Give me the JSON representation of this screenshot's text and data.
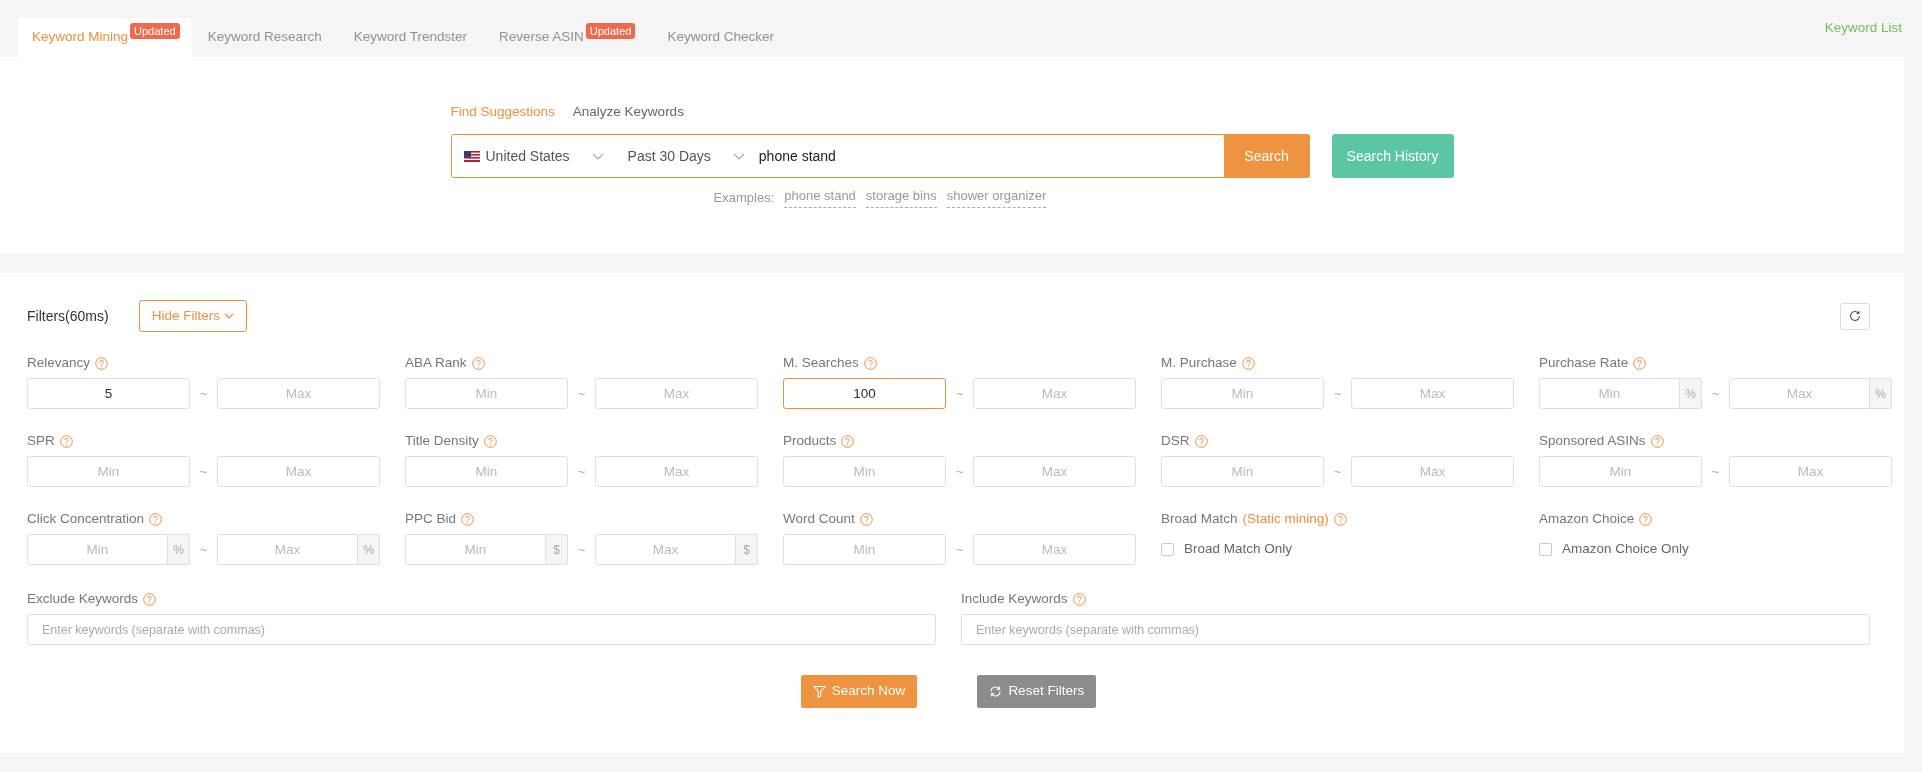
{
  "tabs": [
    {
      "label": "Keyword Mining",
      "badge": "Updated",
      "selected": true
    },
    {
      "label": "Keyword Research",
      "selected": false
    },
    {
      "label": "Keyword Trendster",
      "selected": false
    },
    {
      "label": "Reverse ASIN",
      "badge": "Updated",
      "selected": false
    },
    {
      "label": "Keyword Checker",
      "selected": false
    }
  ],
  "keyword_list_link": "Keyword List",
  "search": {
    "modes": [
      {
        "label": "Find Suggestions",
        "selected": true
      },
      {
        "label": "Analyze Keywords",
        "selected": false
      }
    ],
    "country": "United States",
    "period": "Past 30 Days",
    "query": "phone stand",
    "search_button": "Search",
    "history_button": "Search History",
    "examples_label": "Examples:",
    "examples": [
      "phone stand",
      "storage bins",
      "shower organizer"
    ]
  },
  "filters": {
    "title": "Filters(60ms)",
    "hide_button": "Hide Filters",
    "items": [
      {
        "kind": "range",
        "label": "Relevancy",
        "min": {
          "value": "5"
        },
        "separator": "~",
        "max": {
          "placeholder": "Max"
        }
      },
      {
        "kind": "range",
        "label": "ABA Rank",
        "min": {
          "placeholder": "Min"
        },
        "separator": "~",
        "max": {
          "placeholder": "Max"
        }
      },
      {
        "kind": "range",
        "label": "M. Searches",
        "min": {
          "value": "100",
          "focused": true
        },
        "separator": "~",
        "max": {
          "placeholder": "Max"
        }
      },
      {
        "kind": "range",
        "label": "M. Purchase",
        "min": {
          "placeholder": "Min"
        },
        "separator": "~",
        "max": {
          "placeholder": "Max"
        }
      },
      {
        "kind": "range",
        "label": "Purchase Rate",
        "min": {
          "placeholder": "Min",
          "unit": "%"
        },
        "separator": "~",
        "max": {
          "placeholder": "Max",
          "unit": "%"
        }
      },
      {
        "kind": "range",
        "label": "SPR",
        "min": {
          "placeholder": "Min"
        },
        "separator": "~",
        "max": {
          "placeholder": "Max"
        }
      },
      {
        "kind": "range",
        "label": "Title Density",
        "min": {
          "placeholder": "Min"
        },
        "separator": "~",
        "max": {
          "placeholder": "Max"
        }
      },
      {
        "kind": "range",
        "label": "Products",
        "min": {
          "placeholder": "Min"
        },
        "separator": "~",
        "max": {
          "placeholder": "Max"
        }
      },
      {
        "kind": "range",
        "label": "DSR",
        "min": {
          "placeholder": "Min"
        },
        "separator": "~",
        "max": {
          "placeholder": "Max"
        }
      },
      {
        "kind": "range",
        "label": "Sponsored ASINs",
        "min": {
          "placeholder": "Min"
        },
        "separator": "~",
        "max": {
          "placeholder": "Max"
        }
      },
      {
        "kind": "range",
        "label": "Click Concentration",
        "min": {
          "placeholder": "Min",
          "unit": "%"
        },
        "separator": "~",
        "max": {
          "placeholder": "Max",
          "unit": "%"
        }
      },
      {
        "kind": "range",
        "label": "PPC Bid",
        "min": {
          "placeholder": "Min",
          "unit": "$"
        },
        "separator": "~",
        "max": {
          "placeholder": "Max",
          "unit": "$"
        }
      },
      {
        "kind": "range",
        "label": "Word Count",
        "min": {
          "placeholder": "Min"
        },
        "separator": "~",
        "max": {
          "placeholder": "Max"
        }
      },
      {
        "kind": "checkbox",
        "label": "Broad Match",
        "note": "(Static mining)",
        "option": "Broad Match Only",
        "checked": false
      },
      {
        "kind": "checkbox",
        "label": "Amazon Choice",
        "option": "Amazon Choice Only",
        "checked": false
      }
    ],
    "keywords": [
      {
        "label": "Exclude Keywords",
        "placeholder": "Enter keywords (separate with commas)"
      },
      {
        "label": "Include Keywords",
        "placeholder": "Enter keywords (separate with commas)"
      }
    ],
    "search_now_button": "Search Now",
    "reset_button": "Reset Filters"
  }
}
